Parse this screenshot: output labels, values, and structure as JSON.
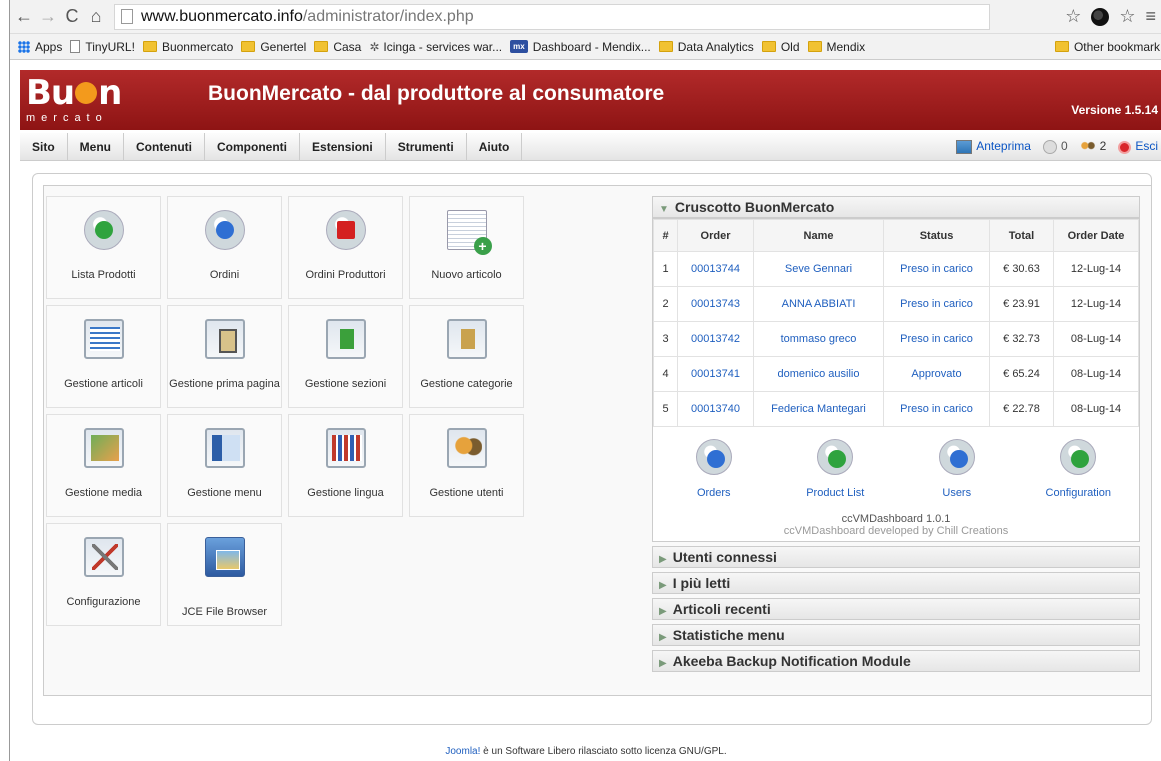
{
  "browser": {
    "url_host": "www.buonmercato.info",
    "url_path": "/administrator/index.php",
    "bookmarks": [
      "Apps",
      "TinyURL!",
      "Buonmercato",
      "Genertel",
      "Casa",
      "Icinga - services war...",
      "Dashboard - Mendix...",
      "Data Analytics",
      "Old",
      "Mendix"
    ],
    "mx_badge": "mx",
    "other_bookmarks": "Other bookmark"
  },
  "header": {
    "logo_word_a": "Bu",
    "logo_word_b": "n",
    "logo_sub": "mercato",
    "title": "BuonMercato - dal produttore al consumatore",
    "version": "Versione 1.5.14"
  },
  "menu": {
    "items": [
      "Sito",
      "Menu",
      "Contenuti",
      "Componenti",
      "Estensioni",
      "Strumenti",
      "Aiuto"
    ],
    "preview": "Anteprima",
    "messages": "0",
    "users": "2",
    "logout": "Esci"
  },
  "cpanel": {
    "tiles": [
      {
        "label": "Lista Prodotti",
        "icon": "product-list-icon"
      },
      {
        "label": "Ordini",
        "icon": "orders-icon"
      },
      {
        "label": "Ordini Produttori",
        "icon": "producer-orders-icon"
      },
      {
        "label": "Nuovo articolo",
        "icon": "new-article-icon"
      },
      {
        "label": "Gestione articoli",
        "icon": "article-manager-icon"
      },
      {
        "label": "Gestione prima pagina",
        "icon": "frontpage-manager-icon"
      },
      {
        "label": "Gestione sezioni",
        "icon": "section-manager-icon"
      },
      {
        "label": "Gestione categorie",
        "icon": "category-manager-icon"
      },
      {
        "label": "Gestione media",
        "icon": "media-manager-icon"
      },
      {
        "label": "Gestione menu",
        "icon": "menu-manager-icon"
      },
      {
        "label": "Gestione lingua",
        "icon": "language-manager-icon"
      },
      {
        "label": "Gestione utenti",
        "icon": "user-manager-icon"
      },
      {
        "label": "Configurazione",
        "icon": "configuration-icon"
      },
      {
        "label": "JCE File Browser",
        "icon": "jce-file-browser-icon"
      }
    ]
  },
  "dashboard": {
    "title": "Cruscotto BuonMercato",
    "columns": [
      "#",
      "Order",
      "Name",
      "Status",
      "Total",
      "Order Date"
    ],
    "rows": [
      {
        "n": "1",
        "order": "00013744",
        "name": "Seve Gennari",
        "status": "Preso in carico",
        "total": "€ 30.63",
        "date": "12-Lug-14"
      },
      {
        "n": "2",
        "order": "00013743",
        "name": "ANNA ABBIATI",
        "status": "Preso in carico",
        "total": "€ 23.91",
        "date": "12-Lug-14"
      },
      {
        "n": "3",
        "order": "00013742",
        "name": "tommaso greco",
        "status": "Preso in carico",
        "total": "€ 32.73",
        "date": "08-Lug-14"
      },
      {
        "n": "4",
        "order": "00013741",
        "name": "domenico ausilio",
        "status": "Approvato",
        "total": "€ 65.24",
        "date": "08-Lug-14"
      },
      {
        "n": "5",
        "order": "00013740",
        "name": "Federica Mantegari",
        "status": "Preso in carico",
        "total": "€ 22.78",
        "date": "08-Lug-14"
      }
    ],
    "links": [
      "Orders",
      "Product List",
      "Users",
      "Configuration"
    ],
    "footer_line1": "ccVMDashboard 1.0.1",
    "footer_line2": "ccVMDashboard developed by Chill Creations"
  },
  "panels": [
    "Utenti connessi",
    "I più letti",
    "Articoli recenti",
    "Statistiche menu",
    "Akeeba Backup Notification Module"
  ],
  "footer": {
    "link": "Joomla!",
    "text": " è un Software Libero rilasciato sotto licenza GNU/GPL."
  }
}
